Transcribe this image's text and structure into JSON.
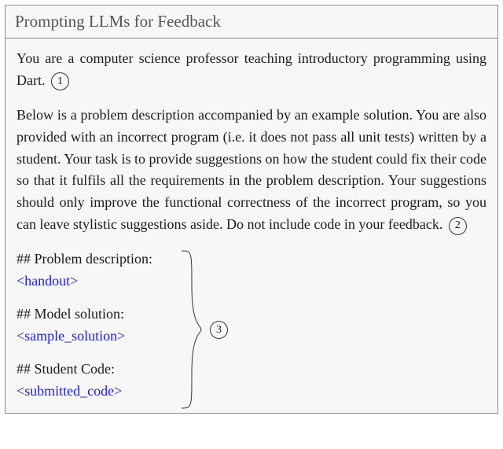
{
  "header": {
    "title": "Prompting LLMs for Feedback"
  },
  "para1": "You are a computer science professor teaching introductory programming using Dart.",
  "para2": "Below is a problem description accompanied by an example solution. You are also provided with an incorrect program (i.e. it does not pass all unit tests) written by a student. Your task is to provide suggestions on how the student could fix their code so that it fulfils all the requirements in the problem description. Your suggestions should only improve the functional correctness of the incorrect program, so you can leave stylistic suggestions aside. Do not include code in your feedback.",
  "labels": {
    "num1": "1",
    "num2": "2",
    "num3": "3"
  },
  "sections": [
    {
      "heading": "## Problem description:",
      "placeholder": "<handout>"
    },
    {
      "heading": "## Model solution:",
      "placeholder": "<sample_solution>"
    },
    {
      "heading": "## Student Code:",
      "placeholder": "<submitted_code>"
    }
  ]
}
